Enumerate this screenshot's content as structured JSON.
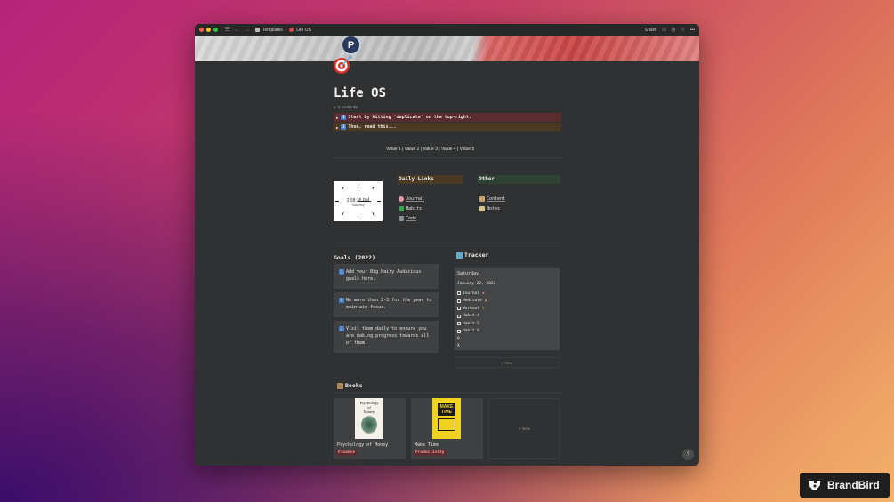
{
  "window": {
    "breadcrumb": [
      "Templates",
      "Life OS"
    ],
    "share_label": "Share"
  },
  "page": {
    "title": "Life OS",
    "backlinks": "2 backlinks",
    "callouts": [
      "Start by hitting 'duplicate' on the top-right.",
      "Then, read this..."
    ],
    "values_line": "Value 1 | Value 2 | Value 3 | Value 4 | Value 5"
  },
  "clock": {
    "time": "2:58:38 PM",
    "day": "Saturday"
  },
  "daily_links": {
    "header": "Daily Links",
    "items": [
      "Journal",
      "Habits",
      "Todo"
    ]
  },
  "other": {
    "header": "Other",
    "items": [
      "Content",
      "Notes"
    ]
  },
  "goals": {
    "title": "Goals (2022)",
    "items": [
      "Add your Big Hairy Audacious goals here.",
      "No more than 2-3 for the year to maintain focus.",
      "Visit them daily to ensure you are making progress towards all of them."
    ]
  },
  "tracker": {
    "title": "Tracker",
    "day": "Saturday",
    "date": "January 22, 2022",
    "habits": [
      "Journal",
      "Meditate",
      "Workout",
      "Habit 4",
      "Habit 5",
      "Habit 6"
    ],
    "extra": [
      "0",
      "X"
    ],
    "new_label": "+ New"
  },
  "books": {
    "title": "Books",
    "items": [
      {
        "name": "Psychology of Money",
        "tag": "Finance",
        "tag_color": "#5b2c2f",
        "tag_text_color": "#f2a0a0"
      },
      {
        "name": "Make Time",
        "tag": "Productivity",
        "tag_color": "#5b2c2f",
        "tag_text_color": "#f2a0a0"
      }
    ],
    "new_label": "+ New",
    "cover1_text": [
      "Psychology",
      "of",
      "Money"
    ],
    "cover2_text": [
      "MAKE",
      "TIME"
    ]
  },
  "help_label": "?",
  "brand": {
    "name": "BrandBird"
  }
}
